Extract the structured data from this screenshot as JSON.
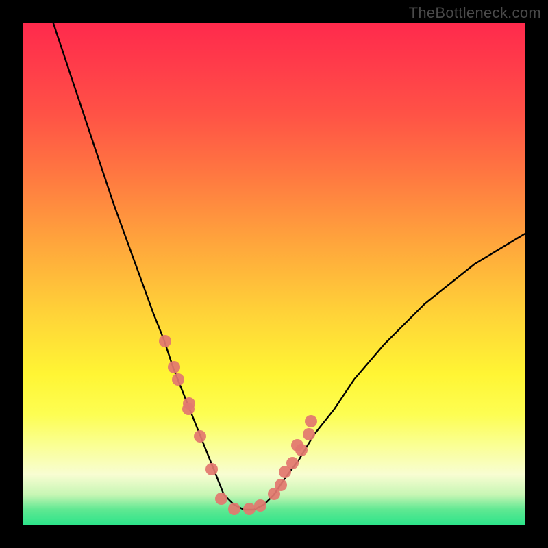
{
  "watermark": "TheBottleneck.com",
  "colors": {
    "background": "#000000",
    "gradient_top": "#ff2a4c",
    "gradient_bottom": "#2de48a",
    "curve": "#000000",
    "dots": "#e2776f"
  },
  "chart_data": {
    "type": "line",
    "title": "",
    "xlabel": "",
    "ylabel": "",
    "xlim": [
      0,
      100
    ],
    "ylim": [
      0,
      100
    ],
    "note": "Axes have no visible ticks or numeric labels; values below are estimated relative coordinates (0–100) read from pixel positions. Higher y = higher on screen. Curve is a V-shaped bottleneck profile with a flat minimum near y≈3 around x≈40–48.",
    "series": [
      {
        "name": "bottleneck-curve",
        "x": [
          6,
          10,
          14,
          18,
          22,
          26,
          28,
          30,
          32,
          34,
          36,
          38,
          40,
          42,
          44,
          46,
          48,
          50,
          52,
          55,
          58,
          62,
          66,
          72,
          80,
          90,
          100
        ],
        "y": [
          100,
          88,
          76,
          64,
          53,
          42,
          37,
          31,
          26,
          21,
          16,
          11,
          6,
          4,
          3,
          3,
          4,
          6,
          9,
          13,
          18,
          23,
          29,
          36,
          44,
          52,
          58
        ]
      },
      {
        "name": "data-points",
        "x": [
          28.3,
          30.1,
          30.9,
          32.9,
          33.1,
          35.2,
          37.5,
          39.5,
          42.1,
          45.1,
          47.3,
          50.0,
          51.4,
          52.2,
          53.7,
          54.6,
          55.5,
          57.0,
          57.4
        ],
        "y": [
          36.6,
          31.4,
          29.0,
          23.1,
          24.2,
          17.6,
          11.1,
          5.2,
          3.1,
          3.1,
          3.8,
          6.1,
          7.9,
          10.5,
          12.3,
          15.8,
          14.9,
          18.0,
          20.6
        ]
      }
    ]
  }
}
